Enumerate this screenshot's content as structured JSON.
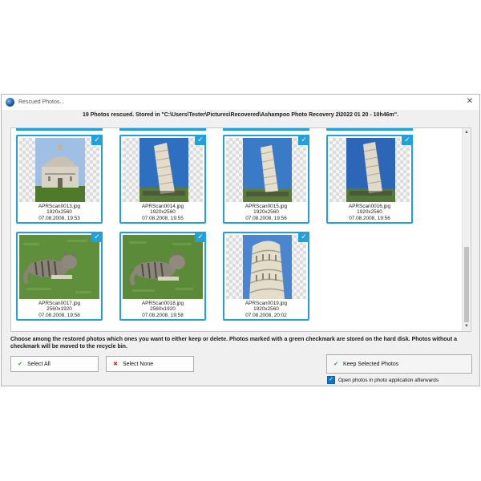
{
  "window": {
    "title": "Rescued Photos...",
    "close_glyph": "✕",
    "app_icon": "globe-icon"
  },
  "status_line": "19 Photos rescued. Stored in \"C:\\Users\\Tester\\Pictures\\Recovered\\Ashampoo Photo Recovery 2\\2022 01 20 - 10h46m\".",
  "photos": [
    {
      "name": "APRScan0013.jpg",
      "size": "1920x2560",
      "date": "07.08.2008, 19:53",
      "checked": true
    },
    {
      "name": "APRScan0014.jpg",
      "size": "1920x2560",
      "date": "07.08.2008, 19:55",
      "checked": true
    },
    {
      "name": "APRScan0015.jpg",
      "size": "1920x2560",
      "date": "07.08.2008, 19:56",
      "checked": true
    },
    {
      "name": "APRScan0016.jpg",
      "size": "1920x2560",
      "date": "07.08.2008, 19:56",
      "checked": true
    },
    {
      "name": "APRScan0017.jpg",
      "size": "2560x1920",
      "date": "07.08.2008, 19:58",
      "checked": true
    },
    {
      "name": "APRScan0018.jpg",
      "size": "2560x1920",
      "date": "07.08.2008, 19:58",
      "checked": true
    },
    {
      "name": "APRScan0019.jpg",
      "size": "1920x2560",
      "date": "07.08.2008, 20:02",
      "checked": true
    }
  ],
  "check_glyph": "✓",
  "scrollbar": {
    "up_glyph": "▲",
    "down_glyph": "▼"
  },
  "instructions": "Choose among the restored photos which ones you want to either keep or delete. Photos marked with a green checkmark are stored on the hard disk. Photos without a checkmark will be moved to the recycle bin.",
  "buttons": {
    "select_all": {
      "label": "Select All",
      "icon": "green-check-icon",
      "glyph": "✔"
    },
    "select_none": {
      "label": "Select None",
      "icon": "red-x-icon",
      "glyph": "✖"
    },
    "keep_selected": {
      "label": "Keep Selected Photos",
      "icon": "green-check-icon",
      "glyph": "✔"
    }
  },
  "option": {
    "label": "Open photos in photo application afterwards",
    "checked": true,
    "glyph": "✓"
  },
  "colors": {
    "accent": "#22a0dc",
    "checkbox": "#0b74d1",
    "green": "#2d9b2d",
    "red": "#d22c2c"
  }
}
